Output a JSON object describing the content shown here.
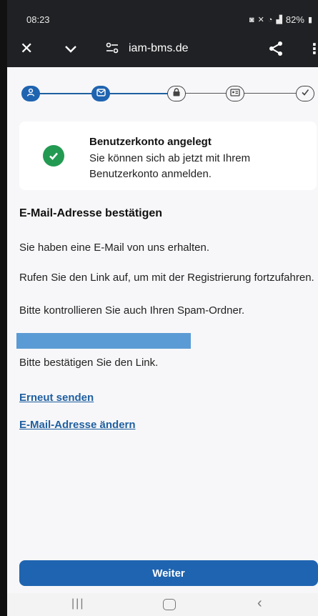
{
  "status_bar": {
    "time": "08:23",
    "battery": "82%"
  },
  "browser": {
    "url": "iam-bms.de"
  },
  "stepper": {
    "steps": [
      {
        "name": "user",
        "state": "done"
      },
      {
        "name": "email",
        "state": "done"
      },
      {
        "name": "lock",
        "state": "todo"
      },
      {
        "name": "id-card",
        "state": "todo"
      },
      {
        "name": "check",
        "state": "todo"
      }
    ]
  },
  "success_card": {
    "title": "Benutzerkonto angelegt",
    "text": "Sie können sich ab jetzt mit Ihrem Benutzerkonto anmelden."
  },
  "content": {
    "heading": "E-Mail-Adresse bestätigen",
    "paragraph_1": "Sie haben eine E-Mail von uns erhalten.",
    "paragraph_2": "Rufen Sie den Link auf, um mit der Registrierung fortzufahren.",
    "paragraph_3": "Bitte kontrollieren Sie auch Ihren Spam-Ordner.",
    "confirm_text": "Bitte bestätigen Sie den Link.",
    "resend_link": "Erneut senden",
    "change_email_link": "E-Mail-Adresse ändern",
    "continue_button": "Weiter"
  },
  "colors": {
    "primary": "#1f64b0",
    "success": "#239a52",
    "redaction": "#5b9bd5"
  }
}
